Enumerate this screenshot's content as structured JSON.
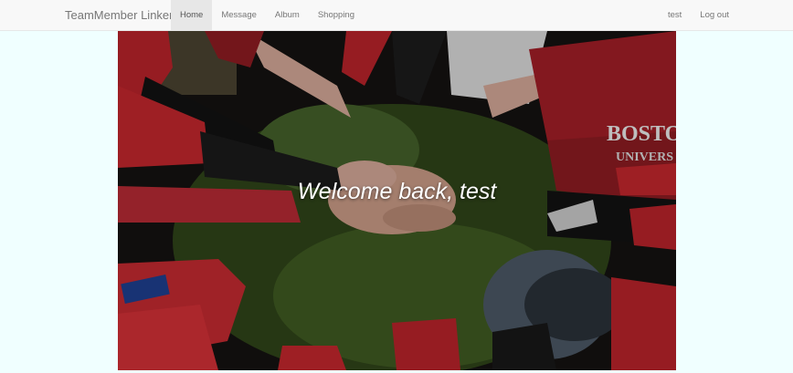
{
  "navbar": {
    "brand": "TeamMember Linker",
    "items": [
      {
        "label": "Home",
        "active": true
      },
      {
        "label": "Message",
        "active": false
      },
      {
        "label": "Album",
        "active": false
      },
      {
        "label": "Shopping",
        "active": false
      }
    ],
    "user": "test",
    "logout": "Log out"
  },
  "hero": {
    "welcome_text": "Welcome back, test",
    "shirt_text": "BOSTON",
    "shirt_sub_text": "UNIVERS",
    "image_subject": "team hands huddle photo"
  },
  "colors": {
    "page_background": "#f0ffff",
    "navbar_background": "#f8f8f8",
    "active_tab": "#e7e7e7",
    "red_sleeve": "#b8232a",
    "grass": "#3f5a22"
  }
}
